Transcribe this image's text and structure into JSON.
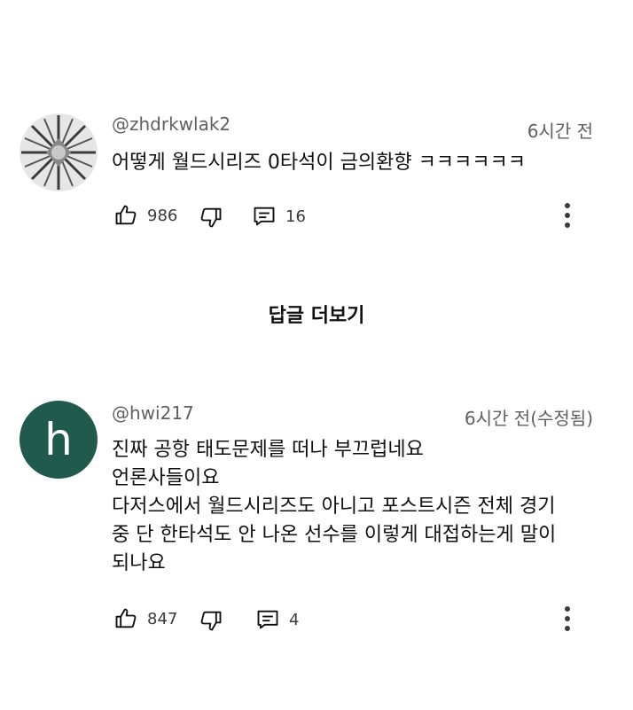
{
  "comments": [
    {
      "handle": "@zhdrkwlak2",
      "time": "6시간 전",
      "text": [
        "어떻게 월드시리즈 0타석이 금의환향 ㅋㅋㅋㅋㅋㅋ"
      ],
      "likes": "986",
      "replies": "16",
      "avatar": "diamond-image"
    },
    {
      "handle": "@hwi217",
      "time": "6시간 전(수정됨)",
      "text": [
        "진짜 공항 태도문제를 떠나 부끄럽네요",
        "언론사들이요",
        "다저스에서 월드시리즈도 아니고 포스트시즌 전체 경기",
        "중 단 한타석도 안 나온 선수를 이렇게 대접하는게 말이",
        "되나요"
      ],
      "likes": "847",
      "replies": "4",
      "avatar_letter": "h",
      "avatar_color": "#1f5a4c"
    }
  ],
  "show_replies_label": "답글 더보기",
  "icons": [
    "thumbs-up-icon",
    "thumbs-down-icon",
    "reply-icon",
    "more-vert-icon"
  ]
}
